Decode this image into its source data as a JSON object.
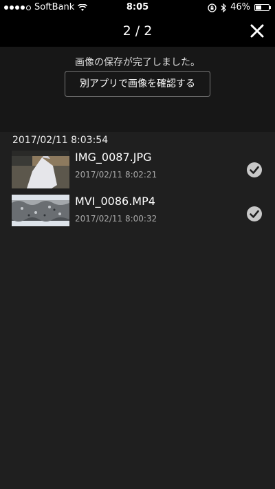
{
  "status_bar": {
    "carrier": "SoftBank",
    "time": "8:05",
    "battery": "46%",
    "battery_level": 0.46
  },
  "nav": {
    "title": "2 / 2"
  },
  "banner": {
    "message": "画像の保存が完了しました。",
    "button_label": "別アプリで画像を確認する"
  },
  "group": {
    "header": "2017/02/11 8:03:54"
  },
  "items": [
    {
      "name": "IMG_0087.JPG",
      "date": "2017/02/11 8:02:21"
    },
    {
      "name": "MVI_0086.MP4",
      "date": "2017/02/11 8:00:32"
    }
  ],
  "icons": {
    "check": "checkmark-circle-icon",
    "close": "close-icon",
    "wifi": "wifi-icon",
    "bluetooth": "bluetooth-icon",
    "orientation_lock": "orientation-lock-icon"
  }
}
